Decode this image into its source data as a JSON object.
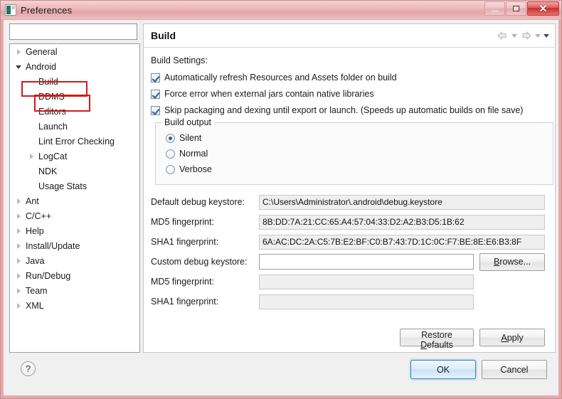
{
  "window": {
    "title": "Preferences",
    "icon": "preferences-icon",
    "controls": {
      "minimize": "minimize-icon",
      "maximize": "maximize-icon",
      "close": "✕"
    }
  },
  "sidebar": {
    "filter": {
      "value": "",
      "placeholder": ""
    },
    "items": [
      {
        "label": "General",
        "indent": 0,
        "state": "collapsed"
      },
      {
        "label": "Android",
        "indent": 0,
        "state": "expanded",
        "highlighted": true
      },
      {
        "label": "Build",
        "indent": 1,
        "state": "leaf",
        "selected": true
      },
      {
        "label": "DDMS",
        "indent": 1,
        "state": "leaf"
      },
      {
        "label": "Editors",
        "indent": 1,
        "state": "leaf"
      },
      {
        "label": "Launch",
        "indent": 1,
        "state": "leaf"
      },
      {
        "label": "Lint Error Checking",
        "indent": 1,
        "state": "leaf"
      },
      {
        "label": "LogCat",
        "indent": 1,
        "state": "collapsed"
      },
      {
        "label": "NDK",
        "indent": 1,
        "state": "leaf"
      },
      {
        "label": "Usage Stats",
        "indent": 1,
        "state": "leaf"
      },
      {
        "label": "Ant",
        "indent": 0,
        "state": "collapsed"
      },
      {
        "label": "C/C++",
        "indent": 0,
        "state": "collapsed"
      },
      {
        "label": "Help",
        "indent": 0,
        "state": "collapsed"
      },
      {
        "label": "Install/Update",
        "indent": 0,
        "state": "collapsed"
      },
      {
        "label": "Java",
        "indent": 0,
        "state": "collapsed"
      },
      {
        "label": "Run/Debug",
        "indent": 0,
        "state": "collapsed"
      },
      {
        "label": "Team",
        "indent": 0,
        "state": "collapsed"
      },
      {
        "label": "XML",
        "indent": 0,
        "state": "collapsed"
      }
    ]
  },
  "page": {
    "title": "Build",
    "nav": {
      "back": "back-arrow-icon",
      "back_menu": "chevron-down-icon",
      "forward": "forward-arrow-icon",
      "forward_menu": "chevron-down-icon",
      "view_menu": "chevron-down-icon"
    },
    "settings_label": "Build Settings:",
    "checkboxes": [
      {
        "label": "Automatically refresh Resources and Assets folder on build",
        "checked": true
      },
      {
        "label": "Force error when external jars contain native libraries",
        "checked": true
      },
      {
        "label": "Skip packaging and dexing until export or launch. (Speeds up automatic builds on file save)",
        "checked": true
      }
    ],
    "build_output": {
      "legend": "Build output",
      "options": [
        {
          "label": "Silent",
          "selected": true
        },
        {
          "label": "Normal",
          "selected": false
        },
        {
          "label": "Verbose",
          "selected": false
        }
      ]
    },
    "fields": [
      {
        "label": "Default debug keystore:",
        "value": "C:\\Users\\Administrator\\.android\\debug.keystore",
        "readonly": true
      },
      {
        "label": "MD5 fingerprint:",
        "value": "8B:DD:7A:21:CC:65:A4:57:04:33:D2:A2:B3:D5:1B:62",
        "readonly": true
      },
      {
        "label": "SHA1 fingerprint:",
        "value": "6A:AC:DC:2A:C5:7B:E2:BF:C0:B7:43:7D:1C:0C:F7:BE:8E:E6:B3:8F",
        "readonly": true
      }
    ],
    "custom_keystore": {
      "label": "Custom debug keystore:",
      "value": "",
      "placeholder": "",
      "browse_label_pre": "",
      "browse_mnemonic": "B",
      "browse_label_post": "rowse..."
    },
    "custom_fields": [
      {
        "label": "MD5 fingerprint:",
        "value": ""
      },
      {
        "label": "SHA1 fingerprint:",
        "value": ""
      }
    ],
    "buttons": {
      "restore_pre": "Restore ",
      "restore_mnemonic": "D",
      "restore_post": "efaults",
      "apply_mnemonic": "A",
      "apply_post": "pply"
    }
  },
  "footer": {
    "help": "?",
    "ok": "OK",
    "cancel": "Cancel"
  },
  "colors": {
    "title_accent": "#e4a4a6",
    "close_red": "#c52f2c",
    "annotation_red": "#d01b1b",
    "focus_blue": "#3c7fb1"
  }
}
